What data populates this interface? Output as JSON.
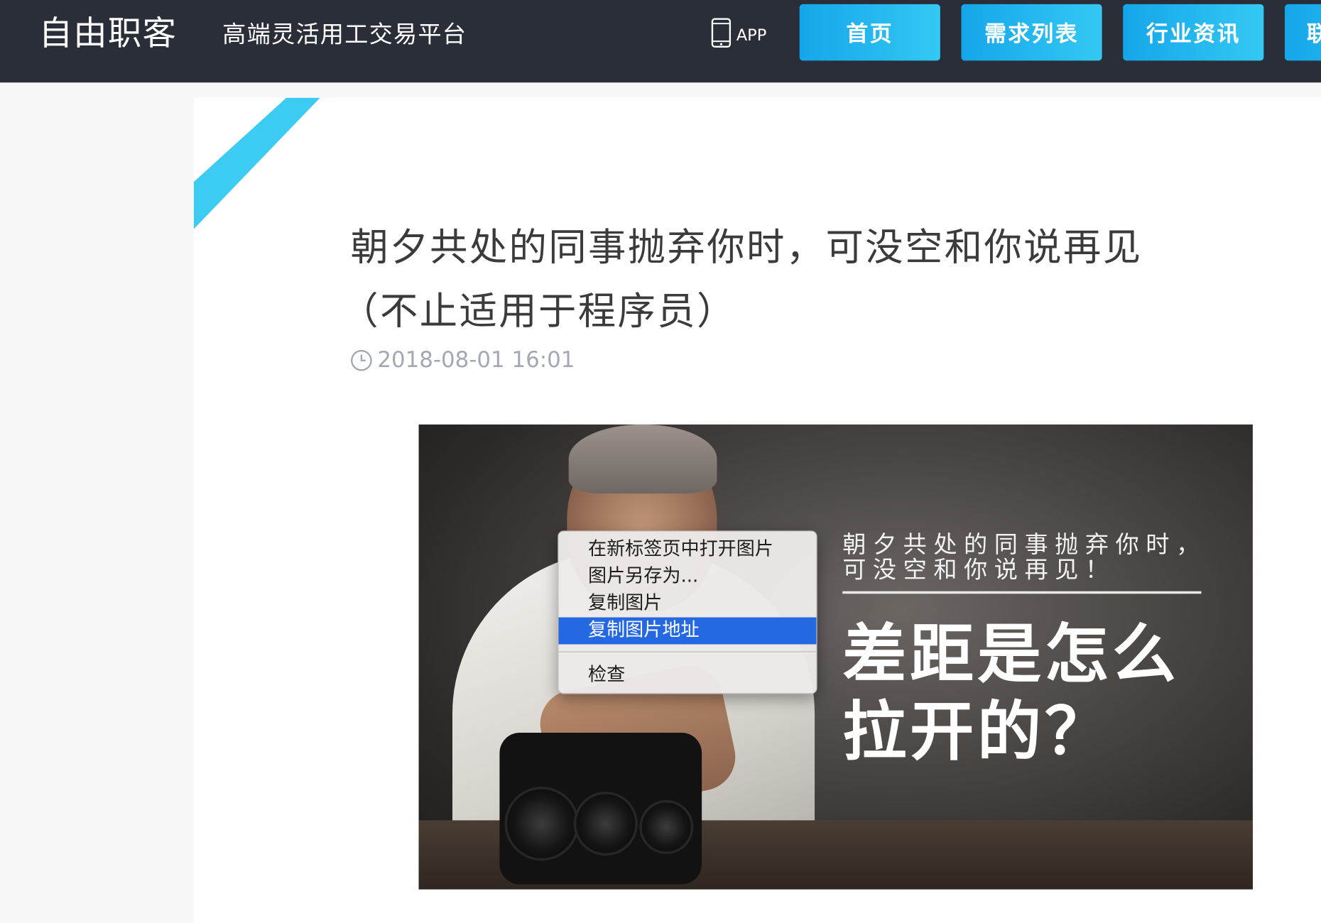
{
  "header": {
    "logo_text": "自由职客",
    "slogan": "高端灵活用工交易平台",
    "app_label": "APP",
    "nav": [
      {
        "label": "首页"
      },
      {
        "label": "需求列表"
      },
      {
        "label": "行业资讯"
      },
      {
        "label": "联"
      }
    ],
    "nav_color": "#1ea8ec",
    "bar_color": "#2a2e38"
  },
  "article": {
    "title_line1": "朝夕共处的同事抛弃你时，可没空和你说再见",
    "title_line2": "（不止适用于程序员）",
    "datetime": "2018-08-01 16:01",
    "accent_color": "#3cccf3"
  },
  "image": {
    "caption_line1": "朝夕共处的同事抛弃你时，",
    "caption_line2": "可没空和你说再见！",
    "headline_line1": "差距是怎么",
    "headline_line2": "拉开的？"
  },
  "context_menu": {
    "items": [
      {
        "label": "在新标签页中打开图片"
      },
      {
        "label": "图片另存为..."
      },
      {
        "label": "复制图片"
      },
      {
        "label": "复制图片地址",
        "highlighted": true
      },
      {
        "label": "检查"
      }
    ],
    "highlight_color": "#2468e2"
  }
}
